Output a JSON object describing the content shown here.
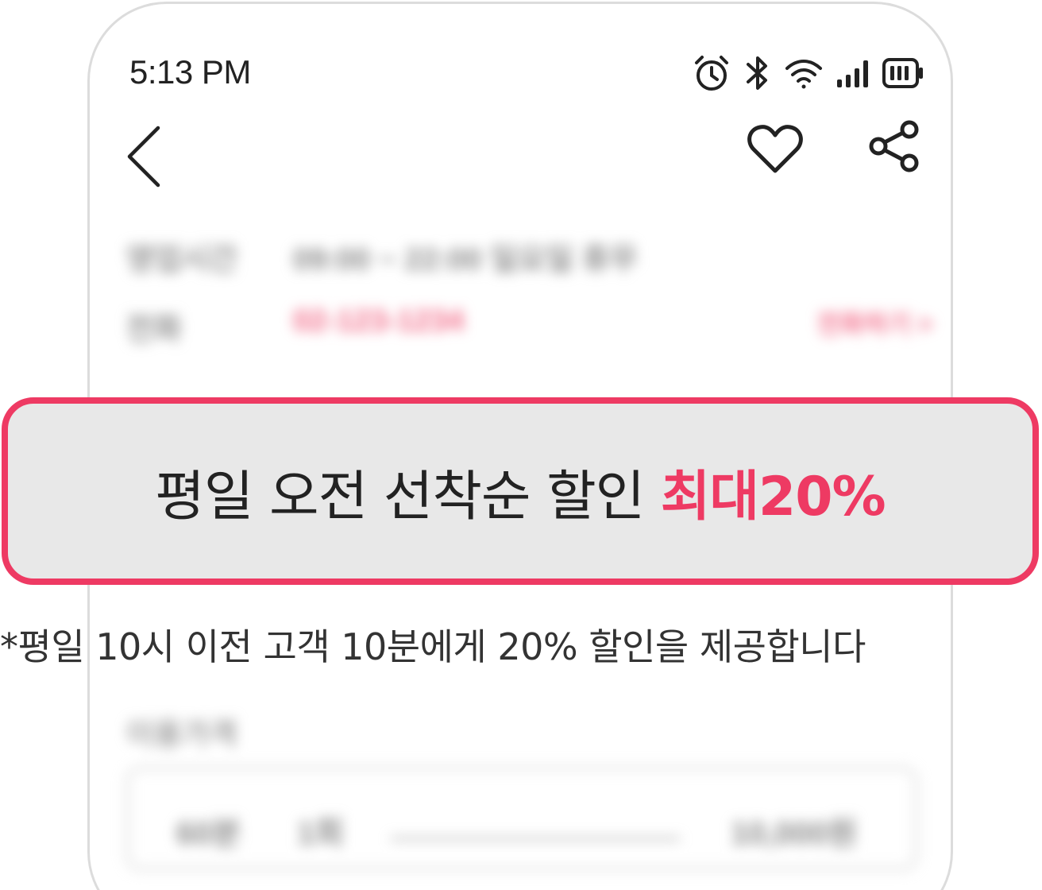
{
  "status_bar": {
    "time": "5:13 PM",
    "icons": [
      "alarm-icon",
      "bluetooth-icon",
      "wifi-icon",
      "signal-icon",
      "battery-icon"
    ]
  },
  "nav_bar": {
    "icons": [
      "back-icon",
      "heart-icon",
      "share-icon"
    ]
  },
  "blurred_info": {
    "hours_label": "영업시간",
    "hours_value": "09:00 ~ 22:00  일요일 휴무",
    "phone_label": "전화",
    "phone_value": "02-123-1234",
    "phone_action": "전화하기 >"
  },
  "blurred_price": {
    "heading": "이용가격",
    "duration": "60분",
    "count": "1회",
    "price": "10,000원"
  },
  "promo": {
    "text": "평일 오전 선착순 할인 ",
    "highlight": "최대20%",
    "note": "*평일 10시 이전 고객 10분에게 20% 할인을 제공합니다"
  },
  "colors": {
    "accent": "#ee3a63",
    "banner_bg": "#e8e8e8",
    "text": "#222222"
  }
}
